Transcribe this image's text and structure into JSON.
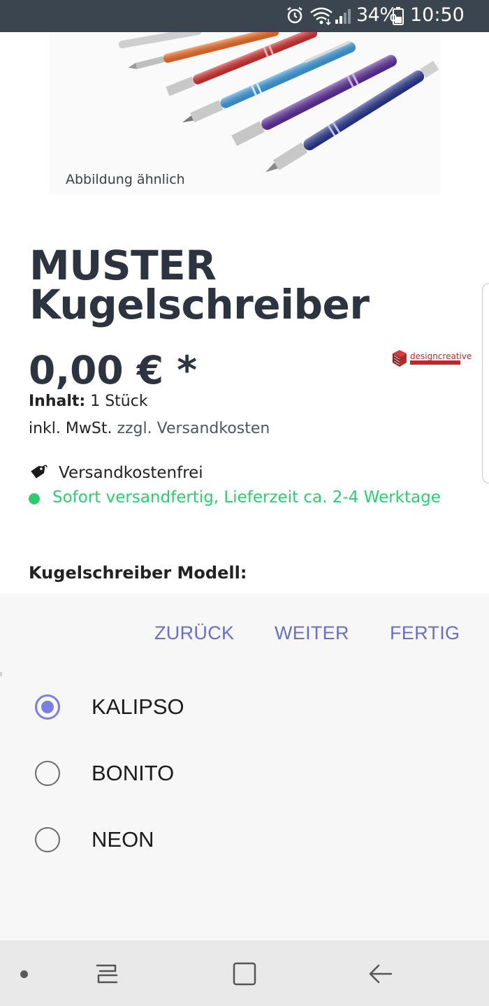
{
  "status_bar": {
    "battery_percent": "34%",
    "time": "10:50",
    "icons": [
      "alarm-icon",
      "wifi-icon",
      "signal-icon",
      "battery-icon"
    ]
  },
  "product": {
    "image_caption": "Abbildung ähnlich",
    "title_line1": "MUSTER",
    "title_line2": "Kugelschreiber",
    "price": "0,00 € *",
    "content_label": "Inhalt:",
    "content_value": " 1 Stück",
    "tax_text": "inkl. MwSt. ",
    "shipping_link": "zzgl. Versandkosten",
    "free_shipping": "Versandkostenfrei",
    "availability": "Sofort versandfertig, Lieferzeit ca. 2-4 Werktage",
    "brand_name": "designcreative",
    "model_label": "Kugelschreiber Modell:"
  },
  "picker": {
    "back_label": "ZURÜCK",
    "next_label": "WEITER",
    "done_label": "FERTIG",
    "options": [
      {
        "label": "KALIPSO",
        "selected": true
      },
      {
        "label": "BONITO",
        "selected": false
      },
      {
        "label": "NEON",
        "selected": false
      }
    ]
  },
  "colors": {
    "accent": "#6a6fc4",
    "radio_selected": "#7b80e0",
    "availability_green": "#2ecc71",
    "status_bar": "#3b4550",
    "pen_colors": [
      "#f26a21",
      "#d42a2a",
      "#3a9be0",
      "#5b2a9a",
      "#26338f"
    ]
  },
  "nav_bar": {
    "icons": [
      "nav-dot-icon",
      "recent-apps-icon",
      "home-icon",
      "back-icon"
    ]
  }
}
